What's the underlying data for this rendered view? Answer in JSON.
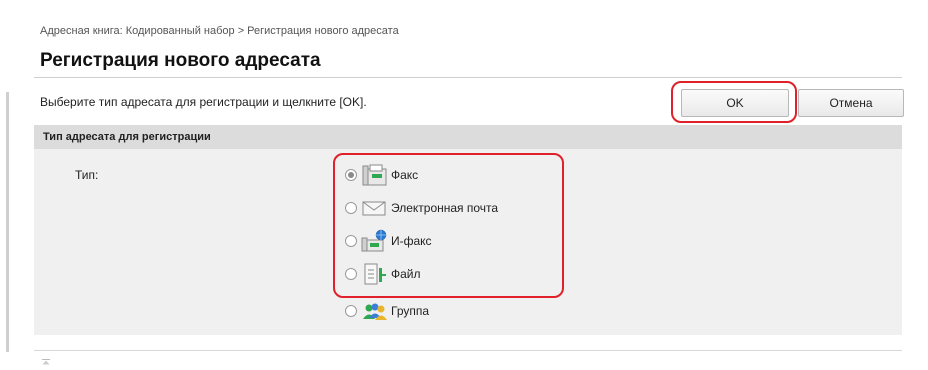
{
  "breadcrumb": "Адресная книга: Кодированный набор > Регистрация нового адресата",
  "page_title": "Регистрация нового адресата",
  "instruction": "Выберите тип адресата для регистрации и щелкните [OK].",
  "buttons": {
    "ok": "OK",
    "cancel": "Отмена"
  },
  "section": {
    "title": "Тип адресата для регистрации",
    "type_label": "Тип:",
    "options": [
      {
        "label": "Факс",
        "icon": "fax-icon",
        "selected": true
      },
      {
        "label": "Электронная почта",
        "icon": "envelope-icon",
        "selected": false
      },
      {
        "label": "И-факс",
        "icon": "ifax-icon",
        "selected": false
      },
      {
        "label": "Файл",
        "icon": "file-icon",
        "selected": false
      },
      {
        "label": "Группа",
        "icon": "group-icon",
        "selected": false
      }
    ]
  },
  "colors": {
    "highlight": "#e0202a",
    "panel": "#f0f0f0",
    "panel_header": "#dcdcdc",
    "icon_green": "#2fa84f"
  }
}
